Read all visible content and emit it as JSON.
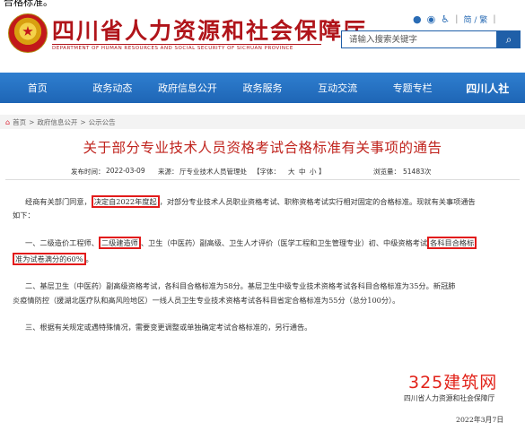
{
  "top_fragment": "合格标准。",
  "header": {
    "site_title": "四川省人力资源和社会保障厅",
    "site_subtitle": "DEPARTMENT OF HUMAN RESOURCES AND SOCIAL SECURITY OF SICHUAN PROVINCE",
    "lang_switch": "简 / 繁",
    "search_placeholder": "请输入搜索关键字",
    "search_icon": "search-icon",
    "util_icons": [
      "weibo-icon",
      "wechat-icon",
      "accessibility-icon"
    ]
  },
  "nav": {
    "items": [
      "首页",
      "政务动态",
      "政府信息公开",
      "政务服务",
      "互动交流",
      "专题专栏",
      "四川人社"
    ]
  },
  "breadcrumb": {
    "home": "首页",
    "sep": ">",
    "level2": "政府信息公开",
    "level3": "公示公告"
  },
  "article": {
    "title": "关于部分专业技术人员资格考试合格标准有关事项的通告",
    "publish_label": "发布时间：",
    "publish_date": "2022-03-09",
    "source_label": "来源：",
    "source": "厅专业技术人员管理处",
    "font_label": "【字体：",
    "font_options": [
      "大",
      "中",
      "小"
    ],
    "font_close": "】",
    "views_label": "浏览量：",
    "views": "51483次",
    "p1_a": "经商有关部门同意，",
    "p1_hl": "决定自2022年度起",
    "p1_b": "，对部分专业技术人员职业资格考试、职称资格考试实行相对固定的合格标准。现就有关事项通告",
    "p1_c": "如下：",
    "p2_a": "一、二级造价工程师、",
    "p2_hl1": "二级建造师",
    "p2_b": "、卫生（中医药）副高级、卫生人才评价（医学工程和卫生管理专业）初、中级资格考试",
    "p2_hl2a": "各科目合格标",
    "p2_hl2b": "准为试卷满分的60%",
    "p2_c": "。",
    "p3_a": "二、基层卫生（中医药）副高级资格考试，各科目合格标准为58分。基层卫生中级专业技术资格考试各科目合格标准为35分。新冠肺",
    "p3_b": "炎疫情防控（援湖北医疗队和高风险地区）一线人员卫生专业技术资格考试各科目省定合格标准为55分（总分100分）。",
    "p4": "三、根据有关规定或遇特殊情况，需要变更调整或单独确定考试合格标准的，另行通告。",
    "signature": "四川省人力资源和社会保障厅",
    "sign_date": "2022年3月7日"
  },
  "watermark": "325建筑网",
  "colors": {
    "brand_red": "#b0141a",
    "title_red": "#c0241e",
    "nav_blue": "#1e65b5",
    "highlight_box": "#e21b1b"
  }
}
